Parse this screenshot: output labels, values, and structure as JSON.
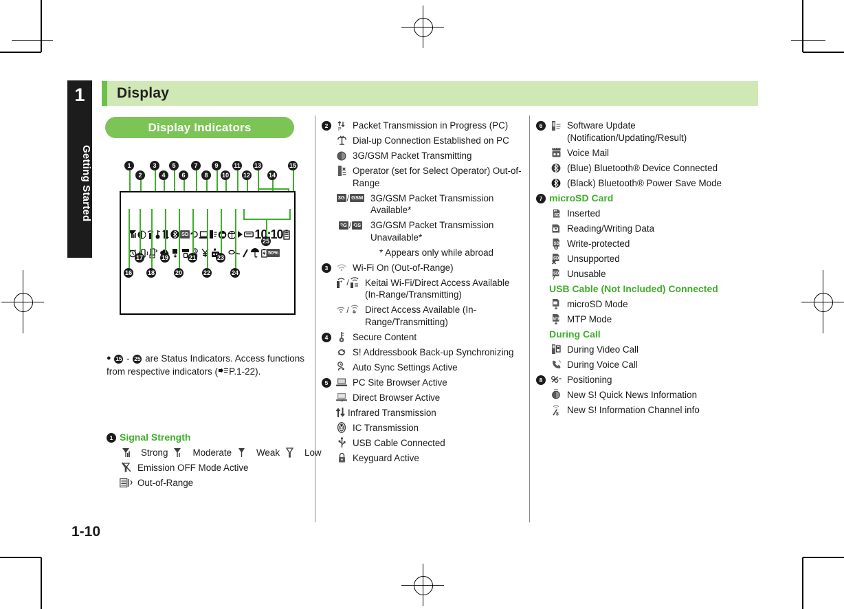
{
  "document": {
    "chapter_number": "1",
    "chapter_title": "Getting Started",
    "page_title": "Display",
    "page_number": "1-10",
    "section_heading": "Display Indicators"
  },
  "figure": {
    "clock": "10:10",
    "battery_label": "50%",
    "callouts_row_top": [
      "1",
      "2",
      "3",
      "4",
      "5",
      "6",
      "7",
      "8",
      "9",
      "10",
      "11",
      "12",
      "13",
      "14",
      "15"
    ],
    "callouts_row_bottom": [
      "16",
      "17",
      "18",
      "19",
      "20",
      "21",
      "22",
      "23",
      "24",
      "25"
    ]
  },
  "note": {
    "bullet": "●",
    "prefix": " ",
    "from": "15",
    "to": "25",
    "text_a": " - ",
    "text_b": " are Status Indicators. Access functions from respective indicators (",
    "ref": "P.1-22",
    "text_c": ")."
  },
  "colors": {
    "accent_green": "#6cc04a",
    "title_bar_green": "#cfe8b6",
    "pill_green": "#7dc457",
    "heading_green": "#3fae2a",
    "tab_black": "#1c1c1c"
  },
  "columns": {
    "left": {
      "groups": [
        {
          "number": "1",
          "heading": "Signal Strength",
          "inline_items": [
            {
              "icon": "signal-strong-icon",
              "label": "Strong"
            },
            {
              "icon": "signal-moderate-icon",
              "label": "Moderate"
            },
            {
              "icon": "signal-weak-icon",
              "label": "Weak"
            },
            {
              "icon": "signal-low-icon",
              "label": "Low"
            }
          ],
          "items": [
            {
              "icon": "emission-off-icon",
              "label": "Emission OFF Mode Active"
            },
            {
              "icon": "out-of-range-icon",
              "label": "Out-of-Range"
            }
          ]
        }
      ]
    },
    "middle": {
      "groups": [
        {
          "number": "2",
          "items": [
            {
              "icon": "packet-pc-icon",
              "label": "Packet Transmission in Progress (PC)"
            },
            {
              "icon": "dialup-pc-icon",
              "label": "Dial-up Connection Established on PC"
            },
            {
              "icon": "globe-packet-icon",
              "label": "3G/GSM Packet Transmitting"
            },
            {
              "icon": "operator-out-of-range-icon",
              "label": "Operator (set for Select Operator) Out-of-Range"
            },
            {
              "icon": "3g-gsm-available-icon",
              "label": "3G/GSM Packet Transmission Available*"
            },
            {
              "icon": "3g-gsm-unavailable-icon",
              "label": "3G/GSM Packet Transmission Unavailable*"
            },
            {
              "icon": "",
              "label": "* Appears only while abroad",
              "sub": true
            }
          ]
        },
        {
          "number": "3",
          "items": [
            {
              "icon": "wifi-on-icon",
              "label": "Wi-Fi On (Out-of-Range)"
            },
            {
              "icon": "keitai-wifi-icon",
              "label": "Keitai Wi-Fi/Direct Access Available (In-Range/Transmitting)"
            },
            {
              "icon": "direct-access-icon",
              "label": "Direct Access Available (In-Range/Transmitting)"
            }
          ]
        },
        {
          "number": "4",
          "items": [
            {
              "icon": "secure-content-icon",
              "label": "Secure Content"
            },
            {
              "icon": "addressbook-sync-icon",
              "label": "S! Addressbook Back-up Synchronizing"
            },
            {
              "icon": "auto-sync-icon",
              "label": "Auto Sync Settings Active"
            }
          ]
        },
        {
          "number": "5",
          "items": [
            {
              "icon": "pc-site-browser-icon",
              "label": "PC Site Browser Active"
            },
            {
              "icon": "direct-browser-icon",
              "label": "Direct Browser Active"
            },
            {
              "icon": "infrared-icon",
              "label": "Infrared Transmission"
            },
            {
              "icon": "ic-transmission-icon",
              "label": "IC Transmission"
            },
            {
              "icon": "usb-cable-icon",
              "label": "USB Cable Connected"
            },
            {
              "icon": "keyguard-icon",
              "label": "Keyguard Active"
            }
          ]
        }
      ]
    },
    "right": {
      "groups": [
        {
          "number": "6",
          "items": [
            {
              "icon": "software-update-icon",
              "label": "Software Update (Notification/Updating/Result)"
            },
            {
              "icon": "voice-mail-icon",
              "label": "Voice Mail"
            },
            {
              "icon": "bluetooth-blue-icon",
              "label": "(Blue)   Bluetooth® Device Connected"
            },
            {
              "icon": "bluetooth-black-icon",
              "label": "(Black) Bluetooth® Power Save Mode"
            }
          ]
        },
        {
          "number": "7",
          "heading": "microSD Card",
          "items": [
            {
              "icon": "microsd-inserted-icon",
              "label": "Inserted"
            },
            {
              "icon": "microsd-reading-icon",
              "label": "Reading/Writing Data"
            },
            {
              "icon": "microsd-write-protected-icon",
              "label": "Write-protected"
            },
            {
              "icon": "microsd-unsupported-icon",
              "label": "Unsupported"
            },
            {
              "icon": "microsd-unusable-icon",
              "label": "Unusable"
            }
          ],
          "subheading_1": "USB Cable (Not Included) Connected",
          "items_2": [
            {
              "icon": "usb-microsd-mode-icon",
              "label": "microSD Mode"
            },
            {
              "icon": "usb-mtp-mode-icon",
              "label": "MTP Mode"
            }
          ],
          "subheading_2": "During Call",
          "items_3": [
            {
              "icon": "video-call-icon",
              "label": "During Video Call"
            },
            {
              "icon": "voice-call-icon",
              "label": "During Voice Call"
            }
          ]
        },
        {
          "number": "8",
          "items": [
            {
              "icon": "positioning-icon",
              "label": "Positioning"
            },
            {
              "icon": "quick-news-icon",
              "label": "New S! Quick News Information"
            },
            {
              "icon": "info-channel-icon",
              "label": "New S! Information Channel info"
            }
          ]
        }
      ]
    }
  }
}
